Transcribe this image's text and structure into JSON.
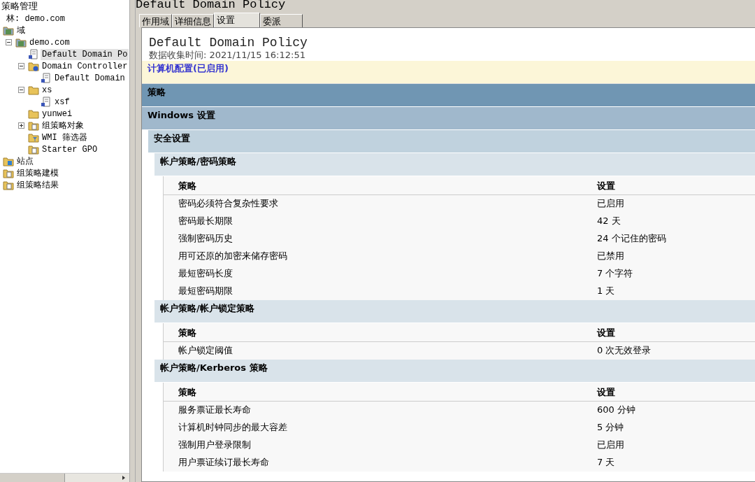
{
  "tree": {
    "title": "策略管理",
    "items": [
      {
        "label": "林: demo.com",
        "selected": false,
        "children": [
          {
            "label": "域",
            "kind": "domains",
            "selected": false,
            "children": [
              {
                "label": "demo.com",
                "kind": "domain",
                "selected": false,
                "expanded": true,
                "children": [
                  {
                    "label": "Default Domain Po",
                    "kind": "link",
                    "selected": true
                  },
                  {
                    "label": "Domain Controller",
                    "kind": "dcunit",
                    "selected": false,
                    "expanded": true,
                    "children": [
                      {
                        "label": "Default Domain",
                        "kind": "link",
                        "selected": false
                      }
                    ]
                  },
                  {
                    "label": "xs",
                    "kind": "unit",
                    "selected": false,
                    "expanded": true,
                    "children": [
                      {
                        "label": "xsf",
                        "kind": "link",
                        "selected": false
                      }
                    ]
                  },
                  {
                    "label": "yunwei",
                    "kind": "unit",
                    "selected": false
                  },
                  {
                    "label": "组策略对象",
                    "kind": "objects",
                    "selected": false,
                    "expanded": false
                  },
                  {
                    "label": "WMI 筛选器",
                    "kind": "filters",
                    "selected": false
                  },
                  {
                    "label": "Starter GPO",
                    "kind": "objects",
                    "selected": false
                  }
                ]
              }
            ]
          },
          {
            "label": "站点",
            "kind": "sites",
            "selected": false
          },
          {
            "label": "组策略建模",
            "kind": "modeling",
            "selected": false
          },
          {
            "label": "组策略结果",
            "kind": "results",
            "selected": false
          }
        ]
      }
    ]
  },
  "title": "Default Domain Policy",
  "tabs": [
    {
      "label": "作用域",
      "selected": false
    },
    {
      "label": "详细信息",
      "selected": false
    },
    {
      "label": "设置",
      "selected": true
    },
    {
      "label": "委派",
      "selected": false
    }
  ],
  "report": {
    "title": "Default Domain Policy",
    "collected": "数据收集时间: 2021/11/15 16:12:51",
    "config": "计算机配置(已启用)",
    "sections": [
      {
        "title": "策略",
        "children": [
          {
            "title": "Windows 设置",
            "children": [
              {
                "title": "安全设置",
                "children": [
                  {
                    "title": "帐户策略/密码策略",
                    "table": {
                      "columns": [
                        "策略",
                        "设置"
                      ],
                      "rows": [
                        [
                          "密码必须符合复杂性要求",
                          "已启用"
                        ],
                        [
                          "密码最长期限",
                          "42 天"
                        ],
                        [
                          "强制密码历史",
                          "24 个记住的密码"
                        ],
                        [
                          "用可还原的加密来储存密码",
                          "已禁用"
                        ],
                        [
                          "最短密码长度",
                          "7 个字符"
                        ],
                        [
                          "最短密码期限",
                          "1 天"
                        ]
                      ]
                    }
                  },
                  {
                    "title": "帐户策略/帐户锁定策略",
                    "table": {
                      "columns": [
                        "策略",
                        "设置"
                      ],
                      "rows": [
                        [
                          "帐户锁定阈值",
                          "0 次无效登录"
                        ]
                      ]
                    }
                  },
                  {
                    "title": "帐户策略/Kerberos 策略",
                    "table": {
                      "columns": [
                        "策略",
                        "设置"
                      ],
                      "rows": [
                        [
                          "服务票证最长寿命",
                          "600 分钟"
                        ],
                        [
                          "计算机时钟同步的最大容差",
                          "5 分钟"
                        ],
                        [
                          "强制用户登录限制",
                          "已启用"
                        ],
                        [
                          "用户票证续订最长寿命",
                          "7 天"
                        ]
                      ]
                    }
                  }
                ]
              }
            ]
          }
        ]
      }
    ]
  }
}
